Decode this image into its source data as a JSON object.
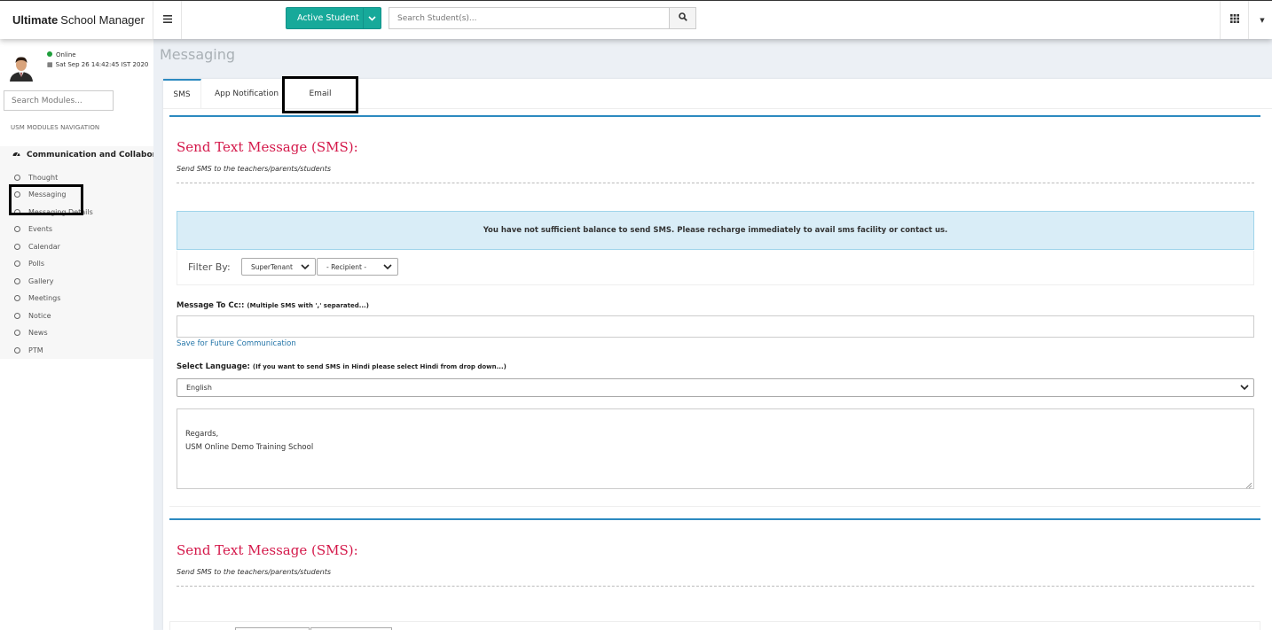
{
  "header": {
    "brand_bold": "Ultimate",
    "brand_rest": "School Manager",
    "menu_icon": "hamburger-icon",
    "active_student_label": "Active Student",
    "search_placeholder": "Search Student(s)...",
    "apps_icon": "grid-icon"
  },
  "sidebar": {
    "status_text": "Online",
    "datetime": "Sat Sep 26 14:42:45 IST 2020",
    "module_search_placeholder": "Search Modules...",
    "nav_heading": "USM MODULES NAVIGATION",
    "group_title": "Communication and Collaboration",
    "items": [
      {
        "label": "Thought"
      },
      {
        "label": "Messaging"
      },
      {
        "label": "Messaging Details"
      },
      {
        "label": "Events"
      },
      {
        "label": "Calendar"
      },
      {
        "label": "Polls"
      },
      {
        "label": "Gallery"
      },
      {
        "label": "Meetings"
      },
      {
        "label": "Notice"
      },
      {
        "label": "News"
      },
      {
        "label": "PTM"
      }
    ]
  },
  "main": {
    "page_title": "Messaging",
    "tabs": [
      {
        "label": "SMS"
      },
      {
        "label": "App Notification"
      },
      {
        "label": "Email"
      }
    ],
    "section": {
      "title": "Send Text Message (SMS):",
      "subtitle": "Send SMS to the teachers/parents/students"
    },
    "alert": "You have not sufficient balance to send SMS. Please recharge immediately to avail sms facility or contact us.",
    "filter_label": "Filter By:",
    "filter_tenant": "SuperTenant",
    "filter_recipient": "- Recipient -",
    "cc_label": "Message To Cc::",
    "cc_hint": "(Multiple SMS with ',' separated...)",
    "save_link": "Save for Future Communication",
    "lang_label": "Select Language:",
    "lang_hint": "(If you want to send SMS in Hindi please select Hindi from drop down...)",
    "lang_value": "English",
    "message_line1": "Regards,",
    "message_line2": "USM Online Demo Training School",
    "section2": {
      "title": "Send Text Message (SMS):",
      "subtitle": "Send SMS to the teachers/parents/students"
    }
  },
  "colors": {
    "accent_teal": "#17a99a",
    "accent_blue": "#2c8ac0",
    "title_red": "#d4184a",
    "alert_bg": "#d9edf7",
    "online_green": "#1e9e3b"
  }
}
